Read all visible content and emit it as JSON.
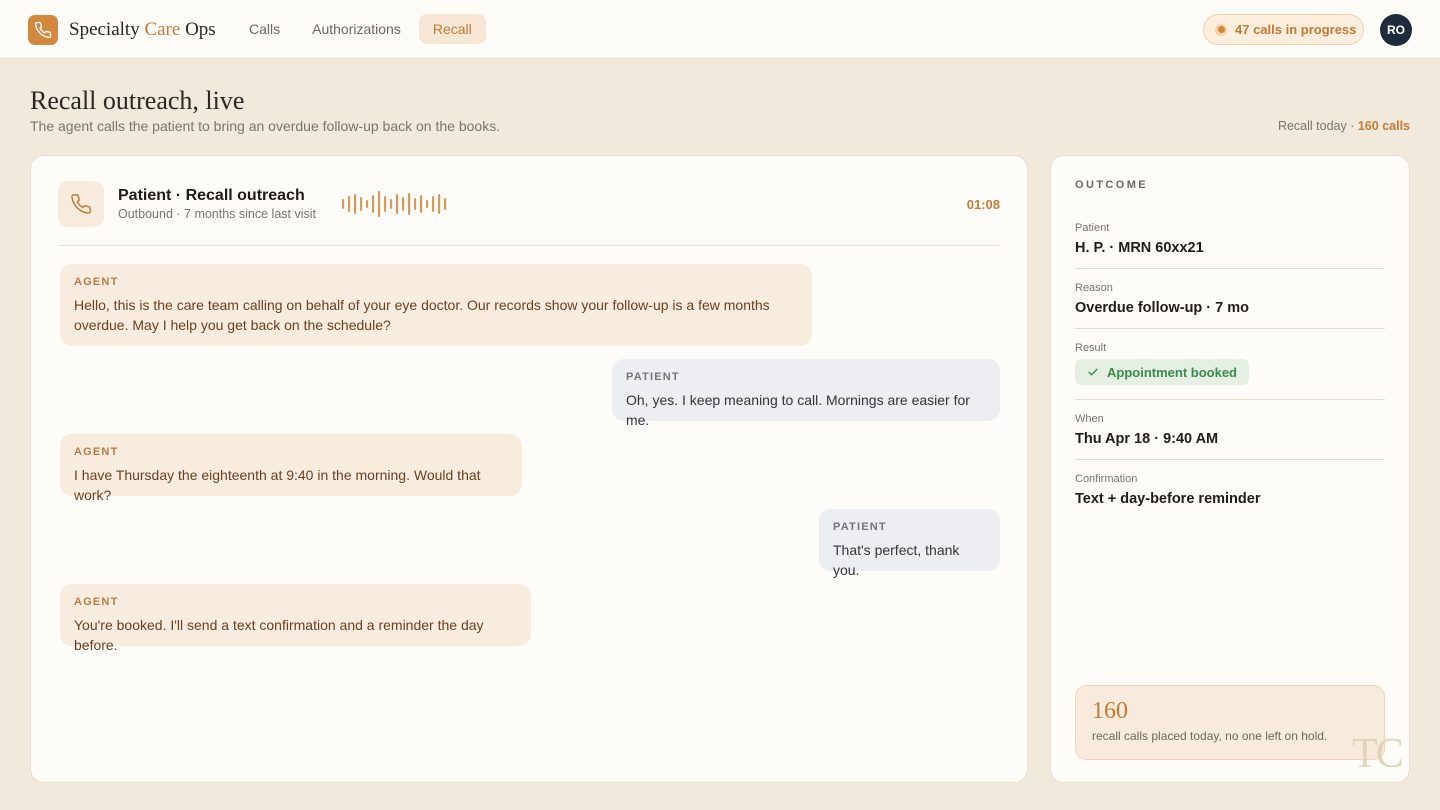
{
  "app": {
    "brand_prefix": "Specialty ",
    "brand_accent": "Care",
    "brand_suffix": " Ops",
    "logo_icon": "phone-icon",
    "accent_color": "#d4883f"
  },
  "nav": {
    "items": [
      {
        "label": "Calls",
        "active": false
      },
      {
        "label": "Authorizations",
        "active": false
      },
      {
        "label": "Recall",
        "active": true
      }
    ]
  },
  "status": {
    "live_calls": "47 calls in progress",
    "avatar_initials": "RO"
  },
  "page": {
    "title": "Recall outreach, live",
    "subtitle": "The agent calls the patient to bring an overdue follow-up back on the books.",
    "recall_today_label": "Recall today · ",
    "recall_today_value": "160 calls"
  },
  "call": {
    "title": "Patient · Recall outreach",
    "subtitle": "Outbound · 7 months since last visit",
    "timer": "01:08",
    "transcript": [
      {
        "speaker": "AGENT",
        "text": "Hello, this is the care team calling on behalf of your eye doctor. Our records show your follow-up is a few months overdue. May I help you get back on the schedule?"
      },
      {
        "speaker": "PATIENT",
        "text": "Oh, yes. I keep meaning to call. Mornings are easier for me."
      },
      {
        "speaker": "AGENT",
        "text": "I have Thursday the eighteenth at 9:40 in the morning. Would that work?"
      },
      {
        "speaker": "PATIENT",
        "text": "That's perfect, thank you."
      },
      {
        "speaker": "AGENT",
        "text": "You're booked. I'll send a text confirmation and a reminder the day before."
      }
    ]
  },
  "outcome": {
    "heading": "OUTCOME",
    "patient_label": "Patient",
    "patient_value": "H. P. · MRN 60xx21",
    "reason_label": "Reason",
    "reason_value": "Overdue follow-up · 7 mo",
    "result_label": "Result",
    "result_value": "Appointment booked",
    "result_color": "#3a8a4c",
    "when_label": "When",
    "when_value": "Thu Apr 18 · 9:40 AM",
    "confirmation_label": "Confirmation",
    "confirmation_value": "Text + day-before reminder"
  },
  "summary": {
    "number": "160",
    "text": "recall calls placed today, no one left on hold."
  },
  "watermark": "TC"
}
